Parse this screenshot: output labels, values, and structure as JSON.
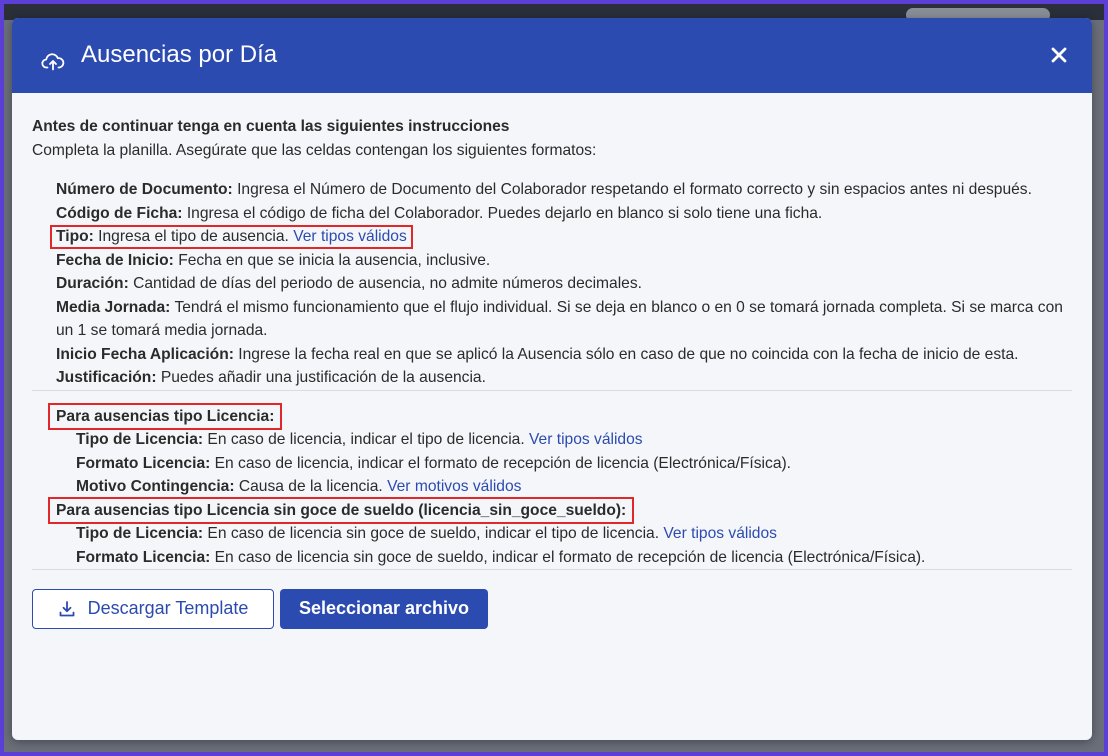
{
  "modal": {
    "title": "Ausencias por Día",
    "header_icon": "cloud-upload-icon",
    "close_icon": "close-icon"
  },
  "intro": {
    "title": "Antes de continuar tenga en cuenta las siguientes instrucciones",
    "text": "Completa la planilla. Asegúrate que las celdas contengan los siguientes formatos:"
  },
  "fields": [
    {
      "label": "Número de Documento:",
      "text": " Ingresa el Número de Documento del Colaborador respetando el formato correcto y sin espacios antes ni después."
    },
    {
      "label": "Código de Ficha:",
      "text": " Ingresa el código de ficha del Colaborador. Puedes dejarlo en blanco si solo tiene una ficha."
    },
    {
      "label": "Tipo:",
      "text": " Ingresa el tipo de ausencia. ",
      "link": "Ver tipos válidos"
    },
    {
      "label": "Fecha de Inicio:",
      "text": " Fecha en que se inicia la ausencia, inclusive."
    },
    {
      "label": "Duración:",
      "text": " Cantidad de días del periodo de ausencia, no admite números decimales."
    },
    {
      "label": "Media Jornada:",
      "text": " Tendrá el mismo funcionamiento que el flujo individual. Si se deja en blanco o en 0 se tomará jornada completa. Si se marca con un 1 se tomará media jornada."
    },
    {
      "label": "Inicio Fecha Aplicación:",
      "text": " Ingrese la fecha real en que se aplicó la Ausencia sólo en caso de que no coincida con la fecha de inicio de esta."
    },
    {
      "label": "Justificación:",
      "text": " Puedes añadir una justificación de la ausencia."
    }
  ],
  "licencia": {
    "heading": "Para ausencias tipo Licencia:",
    "items": [
      {
        "label": "Tipo de Licencia:",
        "text": " En caso de licencia, indicar el tipo de licencia. ",
        "link": "Ver tipos válidos"
      },
      {
        "label": "Formato Licencia:",
        "text": " En caso de licencia, indicar el formato de recepción de licencia (Electrónica/Física)."
      },
      {
        "label": "Motivo Contingencia:",
        "text": " Causa de la licencia. ",
        "link": "Ver motivos válidos"
      }
    ]
  },
  "licencia_sin_goce": {
    "heading": "Para ausencias tipo Licencia sin goce de sueldo (licencia_sin_goce_sueldo):",
    "items": [
      {
        "label": "Tipo de Licencia:",
        "text": " En caso de licencia sin goce de sueldo, indicar el tipo de licencia. ",
        "link": "Ver tipos válidos"
      },
      {
        "label": "Formato Licencia:",
        "text": " En caso de licencia sin goce de sueldo, indicar el formato de recepción de licencia (Electrónica/Física)."
      }
    ]
  },
  "footer": {
    "download_label": "Descargar Template",
    "download_icon": "download-icon",
    "select_label": "Seleccionar archivo"
  },
  "colors": {
    "primary": "#2c4bb0",
    "highlight": "#e0282a",
    "frame": "#5b3fd6"
  }
}
